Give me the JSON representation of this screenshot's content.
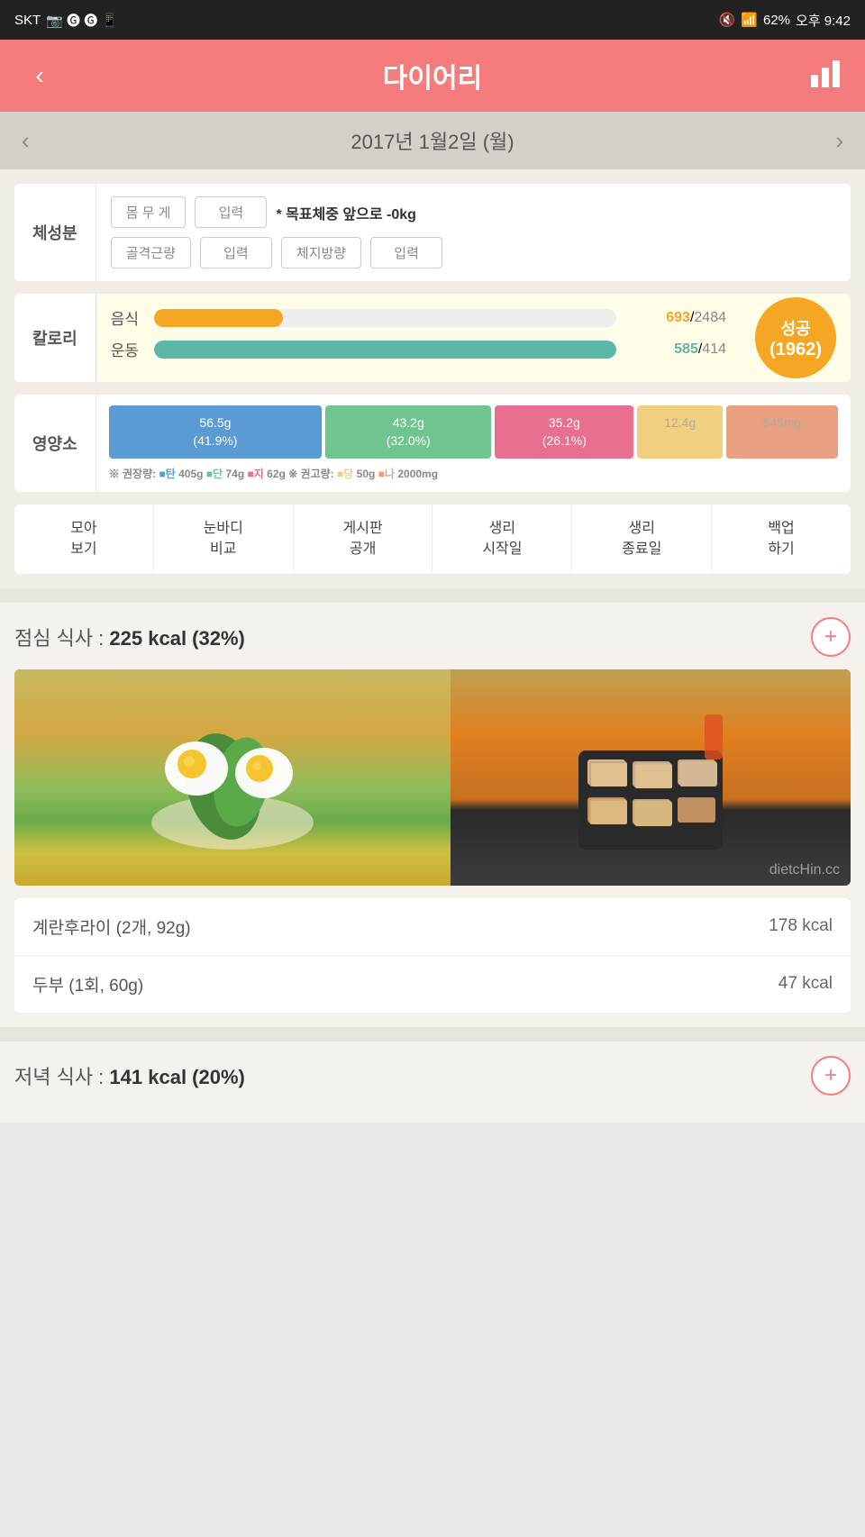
{
  "statusBar": {
    "carrier": "SKT",
    "time": "오후 9:42",
    "battery": "62%",
    "signal": "●●●●",
    "mute": "🔇"
  },
  "header": {
    "title": "다이어리",
    "backIcon": "‹",
    "chartIcon": "chart"
  },
  "dateNav": {
    "prevIcon": "‹",
    "nextIcon": "›",
    "date": "2017년 1월2일 (월)"
  },
  "bodyComp": {
    "sectionLabel": "체성분",
    "weightLabel": "몸 무 게",
    "weightInput": "입력",
    "goalText": "* 목표체중 앞으로 -0kg",
    "muscleLabel": "골격근량",
    "muscleInput": "입력",
    "fatLabel": "체지방량",
    "fatInput": "입력"
  },
  "calories": {
    "sectionLabel": "칼로리",
    "foodLabel": "음식",
    "foodCurrent": "693",
    "foodTotal": "2484",
    "exerciseLabel": "운동",
    "exerciseCurrent": "585",
    "exerciseTotal": "414",
    "badgeLabel": "성공",
    "badgeValue": "(1962)",
    "foodProgress": 27.9,
    "exerciseProgress": 100
  },
  "nutrition": {
    "sectionLabel": "영양소",
    "carbValue": "56.5g",
    "carbPct": "(41.9%)",
    "proteinValue": "43.2g",
    "proteinPct": "(32.0%)",
    "fatValue": "35.2g",
    "fatPct": "(26.1%)",
    "sugarValue": "12.4g",
    "sodiumValue": "545mg",
    "notePrefix": "※ 권장량:",
    "noteCarbLabel": "■탄",
    "noteCarbVal": "405g",
    "noteProteinLabel": "■단",
    "noteProteinVal": "74g",
    "noteFatLabel": "■지",
    "noteFatVal": "62g",
    "noteHighPrefix": "※ 권고량:",
    "noteSugarLabel": "■당",
    "noteSugarVal": "50g",
    "noteSodiumLabel": "■나",
    "noteSodiumVal": "2000mg"
  },
  "actionButtons": [
    {
      "label": "모아\n보기"
    },
    {
      "label": "눈바디\n비교"
    },
    {
      "label": "게시판\n공개"
    },
    {
      "label": "생리\n시작일"
    },
    {
      "label": "생리\n종료일"
    },
    {
      "label": "백업\n하기"
    }
  ],
  "lunch": {
    "title": "점심 식사",
    "calories": "225 kcal (32%)",
    "addIcon": "+",
    "items": [
      {
        "name": "계란후라이 (2개, 92g)",
        "cal": "178 kcal"
      },
      {
        "name": "두부 (1회, 60g)",
        "cal": "47 kcal"
      }
    ],
    "watermark": "dietcHin.cc"
  },
  "dinner": {
    "title": "저녁 식사",
    "calories": "141 kcal (20%)",
    "addIcon": "+"
  }
}
